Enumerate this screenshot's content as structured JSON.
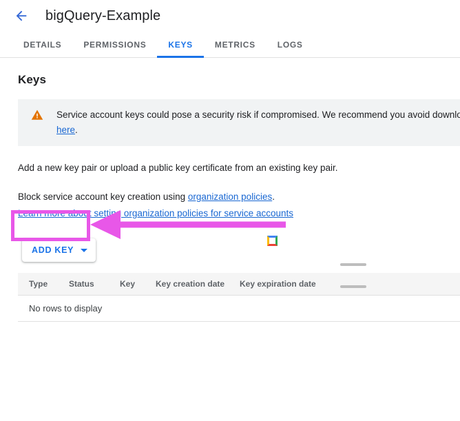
{
  "header": {
    "back_icon": "arrow-left-icon",
    "title": "bigQuery-Example"
  },
  "tabs": [
    {
      "label": "DETAILS",
      "active": false
    },
    {
      "label": "PERMISSIONS",
      "active": false
    },
    {
      "label": "KEYS",
      "active": true
    },
    {
      "label": "METRICS",
      "active": false
    },
    {
      "label": "LOGS",
      "active": false
    }
  ],
  "main": {
    "section_title": "Keys",
    "warning": {
      "icon": "warning-triangle-icon",
      "line1": "Service account keys could pose a security risk if compromised. We recommend you avoid downloa",
      "link_text": "here",
      "line2_suffix": "."
    },
    "paragraph_1": "Add a new key pair or upload a public key certificate from an existing key pair.",
    "paragraph_2_prefix": "Block service account key creation using ",
    "paragraph_2_link": "organization policies",
    "paragraph_2_suffix": ".",
    "paragraph_3_link": "Learn more about setting organization policies for service accounts",
    "add_key_button": "ADD KEY",
    "add_key_caret": "chevron-down-icon",
    "loading_square": "google-color-square-icon"
  },
  "table": {
    "columns": [
      "Type",
      "Status",
      "Key",
      "Key creation date",
      "Key expiration date"
    ],
    "empty_message": "No rows to display",
    "rows": []
  },
  "annotation": {
    "highlight_color": "#e857e8",
    "shapes": [
      "highlight-rectangle",
      "pointer-arrow"
    ]
  }
}
